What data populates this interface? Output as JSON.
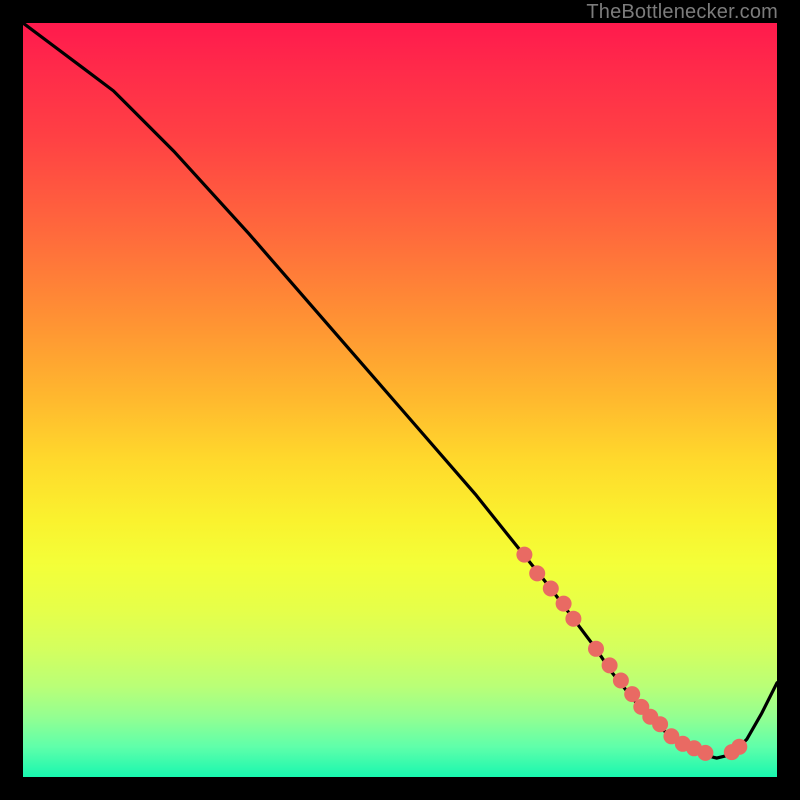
{
  "watermark": "TheBottlenecker.com",
  "chart_data": {
    "type": "line",
    "title": "",
    "xlabel": "",
    "ylabel": "",
    "xlim": [
      0,
      100
    ],
    "ylim": [
      0,
      100
    ],
    "series": [
      {
        "name": "curve",
        "x": [
          0,
          4,
          8,
          12,
          20,
          30,
          40,
          50,
          60,
          66,
          70,
          73,
          76,
          78,
          80,
          82,
          84,
          86,
          88,
          90,
          92,
          94,
          96,
          98,
          100
        ],
        "y": [
          100,
          97,
          94,
          91,
          83,
          72,
          60.5,
          49,
          37.5,
          30,
          25,
          21,
          17,
          14,
          11.5,
          9,
          7,
          5.3,
          4,
          3,
          2.5,
          3,
          5,
          8.5,
          12.5
        ]
      }
    ],
    "markers": {
      "name": "points",
      "color": "#e96a63",
      "radius": 8,
      "x": [
        66.5,
        68.2,
        70.0,
        71.7,
        73.0,
        76.0,
        77.8,
        79.3,
        80.8,
        82.0,
        83.2,
        84.5,
        86.0,
        87.5,
        89.0,
        90.5,
        94.0,
        95.0
      ],
      "y": [
        29.5,
        27.0,
        25.0,
        23.0,
        21.0,
        17.0,
        14.8,
        12.8,
        11.0,
        9.3,
        8.0,
        7.0,
        5.4,
        4.4,
        3.8,
        3.2,
        3.3,
        4.0
      ]
    },
    "gradient_stops": [
      {
        "pos": 0,
        "color": "#ff1a4d"
      },
      {
        "pos": 50,
        "color": "#ffd92c"
      },
      {
        "pos": 75,
        "color": "#eaff42"
      },
      {
        "pos": 100,
        "color": "#18f7af"
      }
    ]
  }
}
